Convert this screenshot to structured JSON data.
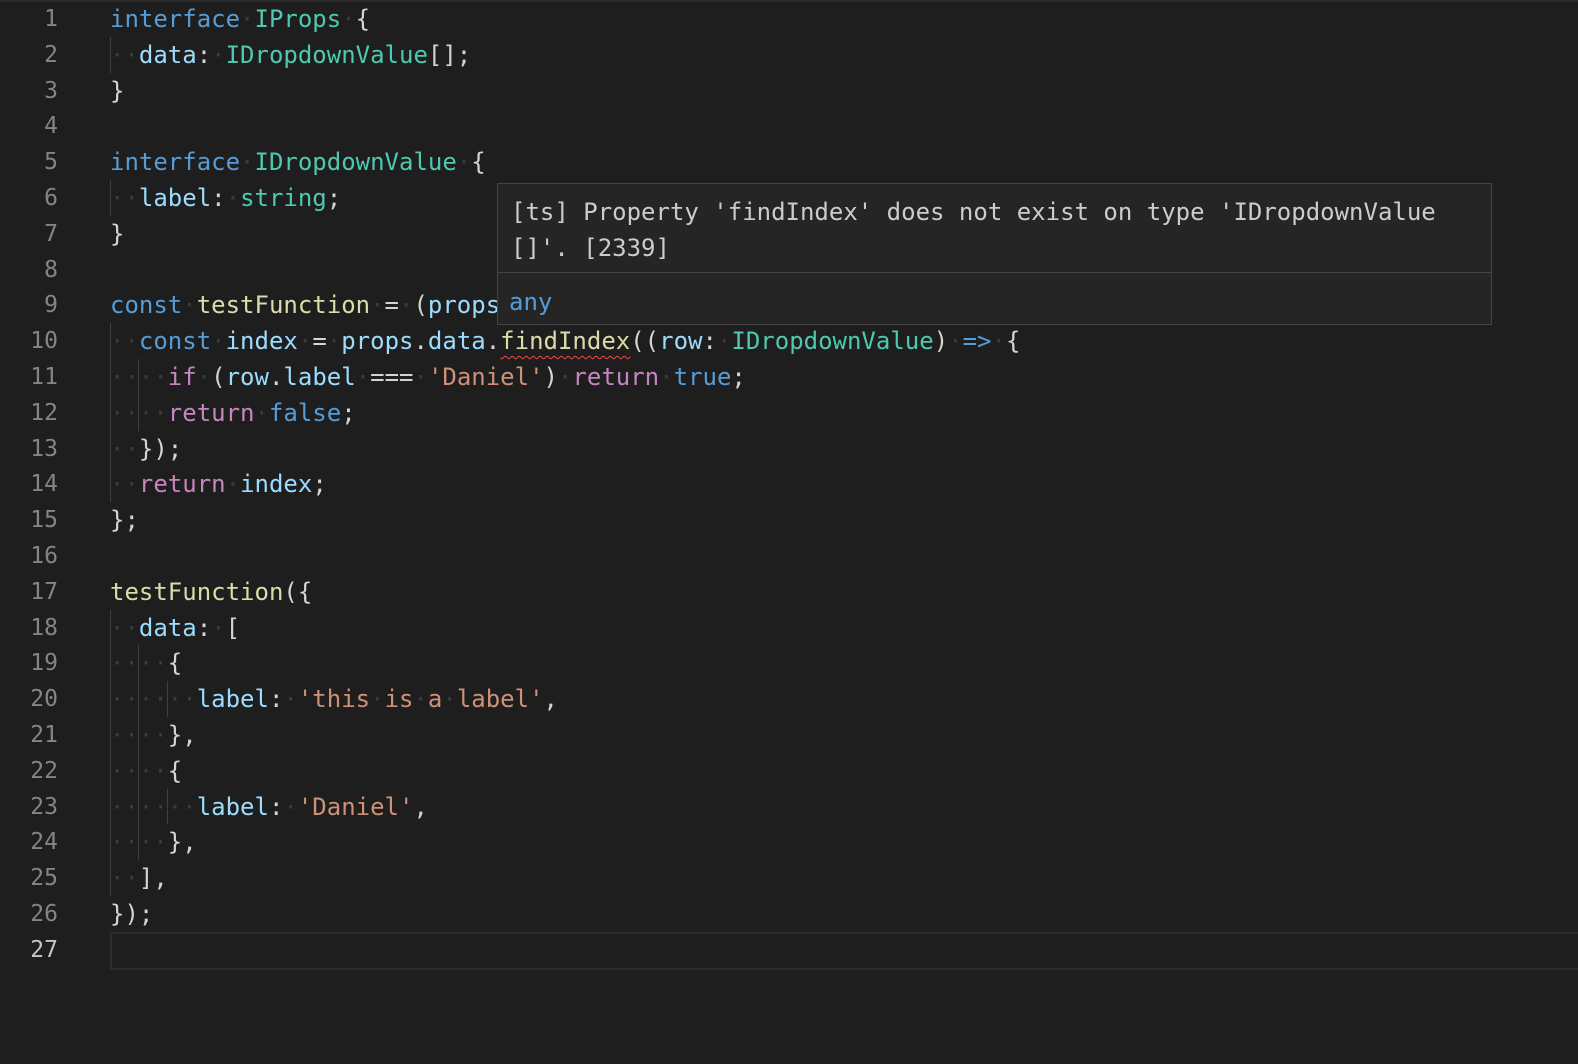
{
  "editor": {
    "language": "typescript",
    "theme_colors": {
      "background": "#1e1e1e",
      "keyword": "#569cd6",
      "control": "#c586c0",
      "type": "#4ec9b0",
      "variable": "#9cdcfe",
      "function": "#dcdcaa",
      "string": "#ce9178",
      "error_squiggle": "#f14c4c"
    },
    "active_line": 27,
    "lines": [
      {
        "n": "1",
        "tokens": [
          [
            "kw",
            "interface"
          ],
          [
            "ws",
            "·"
          ],
          [
            "typ",
            "IProps"
          ],
          [
            "ws",
            "·"
          ],
          [
            "pun",
            "{"
          ]
        ]
      },
      {
        "n": "2",
        "tokens": [
          [
            "ws",
            "··"
          ],
          [
            "var",
            "data"
          ],
          [
            "pun",
            ":"
          ],
          [
            "ws",
            "·"
          ],
          [
            "typ",
            "IDropdownValue"
          ],
          [
            "pun",
            "[];"
          ]
        ]
      },
      {
        "n": "3",
        "tokens": [
          [
            "pun",
            "}"
          ]
        ]
      },
      {
        "n": "4",
        "tokens": []
      },
      {
        "n": "5",
        "tokens": [
          [
            "kw",
            "interface"
          ],
          [
            "ws",
            "·"
          ],
          [
            "typ",
            "IDropdownValue"
          ],
          [
            "ws",
            "·"
          ],
          [
            "pun",
            "{"
          ]
        ]
      },
      {
        "n": "6",
        "tokens": [
          [
            "ws",
            "··"
          ],
          [
            "var",
            "label"
          ],
          [
            "pun",
            ":"
          ],
          [
            "ws",
            "·"
          ],
          [
            "typ",
            "string"
          ],
          [
            "pun",
            ";"
          ]
        ]
      },
      {
        "n": "7",
        "tokens": [
          [
            "pun",
            "}"
          ]
        ]
      },
      {
        "n": "8",
        "tokens": []
      },
      {
        "n": "9",
        "tokens": [
          [
            "kw",
            "const"
          ],
          [
            "ws",
            "·"
          ],
          [
            "fn",
            "testFunction"
          ],
          [
            "ws",
            "·"
          ],
          [
            "pun",
            "="
          ],
          [
            "ws",
            "·"
          ],
          [
            "pun",
            "("
          ],
          [
            "var",
            "props"
          ]
        ]
      },
      {
        "n": "10",
        "tokens": [
          [
            "ws",
            "··"
          ],
          [
            "kw",
            "const"
          ],
          [
            "ws",
            "·"
          ],
          [
            "var",
            "index"
          ],
          [
            "ws",
            "·"
          ],
          [
            "pun",
            "="
          ],
          [
            "ws",
            "·"
          ],
          [
            "var",
            "props"
          ],
          [
            "pun",
            "."
          ],
          [
            "var",
            "data"
          ],
          [
            "pun",
            "."
          ],
          [
            "fn squig",
            "findIndex"
          ],
          [
            "pun",
            "(("
          ],
          [
            "var",
            "row"
          ],
          [
            "pun",
            ":"
          ],
          [
            "ws",
            "·"
          ],
          [
            "typ",
            "IDropdownValue"
          ],
          [
            "pun",
            ")"
          ],
          [
            "ws",
            "·"
          ],
          [
            "kw",
            "=>"
          ],
          [
            "ws",
            "·"
          ],
          [
            "pun",
            "{"
          ]
        ]
      },
      {
        "n": "11",
        "tokens": [
          [
            "ws",
            "····"
          ],
          [
            "ctl",
            "if"
          ],
          [
            "ws",
            "·"
          ],
          [
            "pun",
            "("
          ],
          [
            "var",
            "row"
          ],
          [
            "pun",
            "."
          ],
          [
            "var",
            "label"
          ],
          [
            "ws",
            "·"
          ],
          [
            "pun",
            "==="
          ],
          [
            "ws",
            "·"
          ],
          [
            "str",
            "'Daniel'"
          ],
          [
            "pun",
            ")"
          ],
          [
            "ws",
            "·"
          ],
          [
            "ctl",
            "return"
          ],
          [
            "ws",
            "·"
          ],
          [
            "kw",
            "true"
          ],
          [
            "pun",
            ";"
          ]
        ]
      },
      {
        "n": "12",
        "tokens": [
          [
            "ws",
            "····"
          ],
          [
            "ctl",
            "return"
          ],
          [
            "ws",
            "·"
          ],
          [
            "kw",
            "false"
          ],
          [
            "pun",
            ";"
          ]
        ]
      },
      {
        "n": "13",
        "tokens": [
          [
            "ws",
            "··"
          ],
          [
            "pun",
            "});"
          ]
        ]
      },
      {
        "n": "14",
        "tokens": [
          [
            "ws",
            "··"
          ],
          [
            "ctl",
            "return"
          ],
          [
            "ws",
            "·"
          ],
          [
            "var",
            "index"
          ],
          [
            "pun",
            ";"
          ]
        ]
      },
      {
        "n": "15",
        "tokens": [
          [
            "pun",
            "};"
          ]
        ]
      },
      {
        "n": "16",
        "tokens": []
      },
      {
        "n": "17",
        "tokens": [
          [
            "fn",
            "testFunction"
          ],
          [
            "pun",
            "({"
          ]
        ]
      },
      {
        "n": "18",
        "tokens": [
          [
            "ws",
            "··"
          ],
          [
            "var",
            "data"
          ],
          [
            "pun",
            ":"
          ],
          [
            "ws",
            "·"
          ],
          [
            "pun",
            "["
          ]
        ]
      },
      {
        "n": "19",
        "tokens": [
          [
            "ws",
            "····"
          ],
          [
            "pun",
            "{"
          ]
        ]
      },
      {
        "n": "20",
        "tokens": [
          [
            "ws",
            "······"
          ],
          [
            "var",
            "label"
          ],
          [
            "pun",
            ":"
          ],
          [
            "ws",
            "·"
          ],
          [
            "str",
            "'this"
          ],
          [
            "ws",
            "·"
          ],
          [
            "str",
            "is"
          ],
          [
            "ws",
            "·"
          ],
          [
            "str",
            "a"
          ],
          [
            "ws",
            "·"
          ],
          [
            "str",
            "label'"
          ],
          [
            "pun",
            ","
          ]
        ]
      },
      {
        "n": "21",
        "tokens": [
          [
            "ws",
            "····"
          ],
          [
            "pun",
            "},"
          ]
        ]
      },
      {
        "n": "22",
        "tokens": [
          [
            "ws",
            "····"
          ],
          [
            "pun",
            "{"
          ]
        ]
      },
      {
        "n": "23",
        "tokens": [
          [
            "ws",
            "······"
          ],
          [
            "var",
            "label"
          ],
          [
            "pun",
            ":"
          ],
          [
            "ws",
            "·"
          ],
          [
            "str",
            "'Daniel'"
          ],
          [
            "pun",
            ","
          ]
        ]
      },
      {
        "n": "24",
        "tokens": [
          [
            "ws",
            "····"
          ],
          [
            "pun",
            "},"
          ]
        ]
      },
      {
        "n": "25",
        "tokens": [
          [
            "ws",
            "··"
          ],
          [
            "pun",
            "],"
          ]
        ]
      },
      {
        "n": "26",
        "tokens": [
          [
            "pun",
            "});"
          ]
        ]
      },
      {
        "n": "27",
        "tokens": []
      }
    ]
  },
  "hover": {
    "message": "[ts] Property 'findIndex' does not exist on type 'IDropdownValue[]'. [2339]",
    "type_info": "any"
  }
}
